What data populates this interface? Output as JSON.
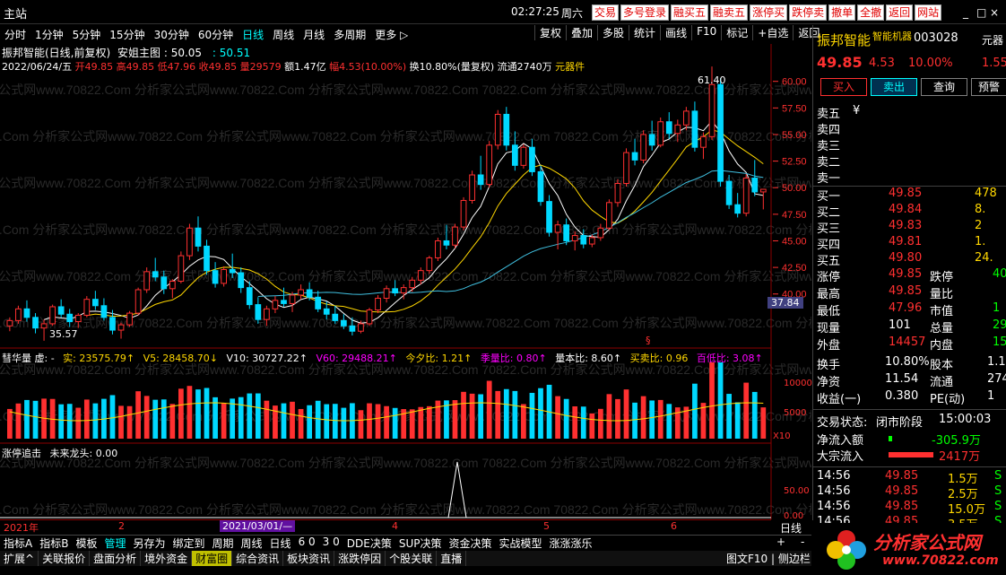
{
  "window": {
    "title": "主站",
    "time": "02:27:25",
    "weekday": "周六",
    "top_buttons": [
      "交易",
      "多号登录",
      "融买五",
      "融卖五",
      "涨停买",
      "跌停卖",
      "撤单",
      "全撤",
      "返回",
      "网站"
    ],
    "controls": [
      "_",
      "□",
      "×"
    ]
  },
  "tabs": [
    "分时",
    "1分钟",
    "5分钟",
    "15分钟",
    "30分钟",
    "60分钟",
    "日线",
    "周线",
    "月线",
    "多周期",
    "更多 ▷"
  ],
  "active_tab": "日线",
  "toolbar": [
    "复权",
    "叠加",
    "多股",
    "统计",
    "画线",
    "F10",
    "标记",
    "+自选",
    "返回"
  ],
  "main_chart": {
    "title": "振邦智能(日线,前复权)",
    "indicator_name": "安姐主图 : 50.05",
    "indicator_val2": ": 50.51",
    "date": "2022/06/24/五",
    "open": "开49.85",
    "high": "高49.85",
    "low": "低47.96",
    "close": "收49.85",
    "volume": "量29579",
    "amount": "额1.47亿",
    "change": "幅4.53(10.00%)",
    "turnover": "换10.80%(量复权)",
    "float_cap": "流通2740万",
    "sector": "元器件",
    "watermark": "70822.Com 分析家公式网www.70822.Com 分析家公式网www.70822.Com 分析家公式网www.70822.Com",
    "high_mark": "61.40",
    "low_mark": "35.57",
    "price_tag": "37.84",
    "price_axis": [
      "60.00",
      "57.50",
      "55.00",
      "52.50",
      "50.00",
      "47.50",
      "45.00",
      "42.50",
      "40.00"
    ],
    "special_mark": "§"
  },
  "chart_data": {
    "type": "candlestick",
    "title": "振邦智能(日线,前复权)",
    "ylim": [
      35,
      62
    ],
    "ohlc": [
      [
        37.0,
        37.8,
        36.5,
        37.5
      ],
      [
        37.5,
        38.9,
        37.2,
        38.6
      ],
      [
        38.6,
        39.4,
        37.4,
        37.8
      ],
      [
        37.8,
        38.2,
        36.3,
        36.8
      ],
      [
        36.8,
        37.6,
        35.6,
        37.2
      ],
      [
        37.2,
        39.0,
        37.0,
        38.8
      ],
      [
        38.8,
        39.5,
        37.8,
        38.1
      ],
      [
        38.1,
        38.6,
        36.9,
        37.4
      ],
      [
        37.4,
        38.2,
        36.8,
        38.0
      ],
      [
        38.0,
        39.8,
        37.8,
        39.5
      ],
      [
        39.5,
        40.3,
        38.5,
        38.9
      ],
      [
        38.9,
        39.6,
        37.5,
        37.8
      ],
      [
        37.8,
        38.5,
        36.2,
        36.6
      ],
      [
        36.6,
        37.3,
        35.8,
        37.1
      ],
      [
        37.1,
        38.4,
        36.9,
        38.2
      ],
      [
        38.2,
        40.6,
        38.0,
        40.4
      ],
      [
        40.4,
        42.5,
        40.1,
        42.1
      ],
      [
        42.1,
        43.4,
        41.2,
        41.6
      ],
      [
        41.6,
        42.2,
        40.0,
        40.5
      ],
      [
        40.5,
        41.4,
        39.6,
        41.2
      ],
      [
        41.2,
        44.0,
        41.0,
        43.6
      ],
      [
        43.6,
        46.6,
        43.2,
        46.2
      ],
      [
        46.2,
        47.3,
        44.0,
        44.5
      ],
      [
        44.5,
        45.1,
        41.8,
        42.2
      ],
      [
        42.2,
        43.0,
        40.6,
        41.0
      ],
      [
        41.0,
        42.6,
        40.7,
        42.3
      ],
      [
        42.3,
        43.8,
        41.5,
        42.0
      ],
      [
        42.0,
        42.5,
        40.1,
        40.6
      ],
      [
        40.6,
        41.2,
        38.6,
        39.0
      ],
      [
        39.0,
        39.7,
        37.2,
        37.6
      ],
      [
        37.6,
        38.9,
        37.0,
        38.6
      ],
      [
        38.6,
        39.8,
        38.2,
        39.4
      ],
      [
        39.4,
        40.6,
        38.8,
        39.1
      ],
      [
        39.1,
        40.2,
        38.3,
        39.9
      ],
      [
        39.9,
        40.9,
        39.5,
        40.4
      ],
      [
        40.4,
        41.1,
        39.4,
        39.7
      ],
      [
        39.7,
        40.3,
        38.3,
        38.6
      ],
      [
        38.6,
        39.3,
        37.6,
        38.1
      ],
      [
        38.1,
        38.9,
        37.2,
        37.5
      ],
      [
        37.5,
        38.1,
        36.7,
        37.0
      ],
      [
        37.0,
        37.8,
        36.1,
        36.5
      ],
      [
        36.5,
        37.5,
        36.3,
        37.2
      ],
      [
        37.2,
        38.7,
        37.0,
        38.5
      ],
      [
        38.5,
        39.9,
        38.2,
        39.6
      ],
      [
        39.6,
        40.8,
        39.2,
        40.5
      ],
      [
        40.5,
        41.3,
        39.8,
        40.1
      ],
      [
        40.1,
        40.9,
        39.5,
        40.6
      ],
      [
        40.6,
        41.6,
        40.2,
        41.3
      ],
      [
        41.3,
        42.5,
        40.9,
        42.2
      ],
      [
        42.2,
        43.6,
        41.9,
        43.4
      ],
      [
        43.4,
        45.3,
        43.1,
        45.0
      ],
      [
        45.0,
        46.5,
        44.2,
        44.6
      ],
      [
        44.6,
        46.6,
        44.3,
        46.3
      ],
      [
        46.3,
        49.1,
        46.0,
        48.8
      ],
      [
        48.8,
        51.6,
        48.5,
        51.2
      ],
      [
        51.2,
        53.0,
        49.8,
        50.3
      ],
      [
        50.3,
        54.4,
        50.0,
        54.0
      ],
      [
        54.0,
        57.3,
        53.6,
        56.9
      ],
      [
        56.9,
        57.6,
        53.5,
        54.0
      ],
      [
        54.0,
        55.3,
        51.6,
        52.1
      ],
      [
        52.1,
        54.1,
        51.8,
        53.8
      ],
      [
        53.8,
        54.6,
        51.1,
        51.5
      ],
      [
        51.5,
        52.1,
        48.3,
        48.7
      ],
      [
        48.7,
        49.3,
        45.4,
        45.8
      ],
      [
        45.8,
        46.9,
        44.2,
        46.5
      ],
      [
        46.5,
        47.1,
        44.6,
        45.0
      ],
      [
        45.0,
        45.9,
        44.1,
        45.5
      ],
      [
        45.5,
        46.1,
        44.3,
        44.7
      ],
      [
        44.7,
        45.6,
        44.4,
        45.3
      ],
      [
        45.3,
        46.6,
        45.0,
        46.2
      ],
      [
        46.2,
        48.9,
        46.0,
        48.6
      ],
      [
        48.6,
        50.8,
        48.2,
        50.4
      ],
      [
        50.4,
        53.7,
        50.1,
        53.3
      ],
      [
        53.3,
        54.6,
        52.1,
        52.6
      ],
      [
        52.6,
        55.4,
        52.3,
        55.0
      ],
      [
        55.0,
        56.3,
        53.5,
        54.0
      ],
      [
        54.0,
        56.6,
        53.8,
        56.2
      ],
      [
        56.2,
        57.1,
        54.6,
        55.1
      ],
      [
        55.1,
        56.4,
        54.3,
        55.9
      ],
      [
        55.9,
        57.6,
        55.4,
        57.2
      ],
      [
        57.2,
        58.1,
        53.4,
        53.8
      ],
      [
        53.8,
        55.2,
        52.7,
        54.8
      ],
      [
        54.8,
        61.4,
        54.5,
        59.7
      ],
      [
        59.7,
        60.3,
        50.1,
        50.6
      ],
      [
        50.6,
        51.2,
        48.0,
        48.4
      ],
      [
        48.4,
        49.5,
        47.2,
        47.6
      ],
      [
        47.6,
        51.3,
        47.3,
        50.9
      ],
      [
        50.9,
        52.6,
        49.2,
        49.6
      ],
      [
        49.6,
        49.85,
        47.96,
        49.85
      ]
    ]
  },
  "indicator1": {
    "name": "彗华量 虚: -",
    "shi": "实: 23575.79↑",
    "v5": "V5: 28458.70↓",
    "v10": "V10: 30727.22↑",
    "v60": "V60: 29488.21↑",
    "jinxi": "今夕比: 1.21↑",
    "jilu": "季量比: 0.80↑",
    "liangben": "量本比: 8.60↑",
    "maimai": "买卖比: 0.96",
    "baidi": "百低比: 3.08↑",
    "axis": [
      "10000",
      "5000",
      "X10"
    ]
  },
  "indicator2": {
    "name": "涨停追击",
    "sub": "未来龙头: 0.00",
    "axis": [
      "50.00",
      "0.00"
    ]
  },
  "time_axis": {
    "labels": [
      "2021年",
      "2",
      "2021/03/01/—",
      "4",
      "5",
      "6"
    ],
    "period": "日线"
  },
  "quote": {
    "stock_name": "振邦智能",
    "sub_name": "智能机器",
    "code": "003028",
    "corner": "元器",
    "price": "49.85",
    "change": "4.53",
    "pct": "10.00%",
    "pct2": "1.55",
    "buttons": [
      "买入",
      "卖出",
      "查询",
      "预警"
    ],
    "sell": [
      {
        "label": "卖五",
        "p": "¥",
        "v": ""
      },
      {
        "label": "卖四",
        "p": "",
        "v": ""
      },
      {
        "label": "卖三",
        "p": "",
        "v": ""
      },
      {
        "label": "卖二",
        "p": "",
        "v": ""
      },
      {
        "label": "卖一",
        "p": "",
        "v": ""
      }
    ],
    "buy": [
      {
        "label": "买一",
        "p": "49.85",
        "v": "478"
      },
      {
        "label": "买二",
        "p": "49.84",
        "v": "8."
      },
      {
        "label": "买三",
        "p": "49.83",
        "v": "2"
      },
      {
        "label": "买四",
        "p": "49.81",
        "v": "1."
      },
      {
        "label": "买五",
        "p": "49.80",
        "v": "24."
      }
    ],
    "stats": [
      {
        "k": "涨停",
        "v": "49.85",
        "k2": "跌停",
        "v2": "40"
      },
      {
        "k": "最高",
        "v": "49.85",
        "k2": "量比",
        "v2": ""
      },
      {
        "k": "最低",
        "v": "47.96",
        "k2": "市值",
        "v2": "1"
      },
      {
        "k": "现量",
        "v": "101",
        "k2": "总量",
        "v2": "29"
      },
      {
        "k": "外盘",
        "v": "14457",
        "k2": "内盘",
        "v2": "15"
      }
    ],
    "fund": [
      {
        "k": "换手",
        "v": "10.80%",
        "k2": "股本",
        "v2": "1.1"
      },
      {
        "k": "净资",
        "v": "11.54",
        "k2": "流通",
        "v2": "274"
      },
      {
        "k": "收益(一)",
        "v": "0.380",
        "k2": "PE(动)",
        "v2": "1"
      }
    ],
    "trade_status_label": "交易状态:",
    "trade_status": "闭市阶段",
    "trade_time": "15:00:03",
    "net_inflow_label": "净流入额",
    "net_inflow": "-305.9万",
    "block_label": "大宗流入",
    "block": "2417万",
    "ticks": [
      {
        "t": "14:56",
        "p": "49.85",
        "v": "1.5万",
        "s": "S"
      },
      {
        "t": "14:56",
        "p": "49.85",
        "v": "2.5万",
        "s": "S"
      },
      {
        "t": "14:56",
        "p": "49.85",
        "v": "15.0万",
        "s": "S"
      },
      {
        "t": "14:56",
        "p": "49.85",
        "v": "3.5万",
        "s": "S"
      }
    ]
  },
  "bottom_tabs1": [
    "指标A",
    "指标B",
    "模板",
    "管理",
    "另存为",
    "绑定到",
    "周期",
    "周线",
    "日线",
    "6 0",
    "3 0",
    "DDE决策",
    "SUP决策",
    "资金决策",
    "实战模型",
    "涨涨涨乐"
  ],
  "bottom_tabs1_right": [
    "+",
    "-"
  ],
  "bottom_tabs2": [
    "扩展^",
    "关联报价",
    "盘面分析",
    "境外资金",
    "财富圈",
    "综合资讯",
    "板块资讯",
    "涨跌停因",
    "个股关联",
    "直播"
  ],
  "bottom_right_label": "图文F10 | 侧边栏《",
  "logo": {
    "text": "分析家公式网",
    "url": "www.70822.com"
  }
}
